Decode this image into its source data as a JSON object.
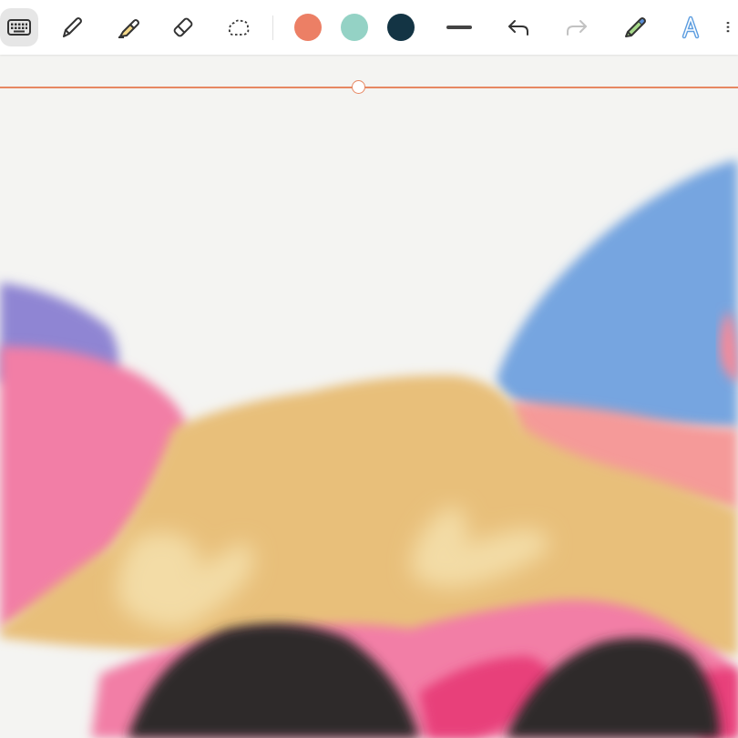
{
  "toolbar": {
    "tools": [
      "keyboard-icon",
      "pen-icon",
      "highlighter-icon",
      "eraser-icon",
      "lasso-icon"
    ],
    "colors": [
      "#ec7f65",
      "#94d2c5",
      "#133444"
    ],
    "active_color": "#ec7f65",
    "actions": [
      "stroke-width-icon",
      "undo-icon",
      "redo-icon",
      "marker-tool-icon",
      "text-style-icon",
      "more-icon"
    ]
  },
  "ruler": {
    "color": "#e78762"
  },
  "canvas": {
    "background": "#f4f4f2",
    "palette": {
      "lavender": "#8f85d3",
      "pink": "#f27ea6",
      "tan": "#e8bf7a",
      "cream": "#f3dca6",
      "blue": "#76a5e0",
      "salmon": "#f59a99",
      "dark": "#2f2b2a",
      "magenta": "#e8407a"
    }
  }
}
